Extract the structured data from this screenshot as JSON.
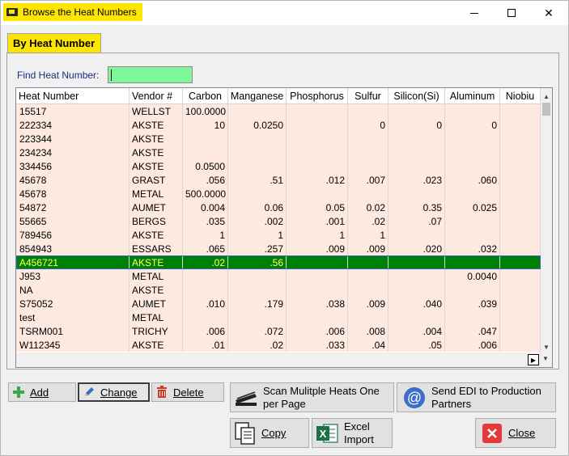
{
  "window": {
    "title": "Browse the Heat Numbers",
    "controls": {
      "minimize": "",
      "maximize": "",
      "close": "✕"
    }
  },
  "tab": {
    "label": "By Heat Number"
  },
  "find": {
    "label": "Find Heat Number:",
    "value": ""
  },
  "table": {
    "columns": [
      "Heat Number",
      "Vendor #",
      "Carbon",
      "Manganese",
      "Phosphorus",
      "Sulfur",
      "Silicon(Si)",
      "Aluminum",
      "Niobiu"
    ],
    "rows": [
      [
        "15517",
        "WELLST",
        "100.0000",
        "",
        "",
        "",
        "",
        "",
        ""
      ],
      [
        "222334",
        "AKSTE",
        "10",
        "0.0250",
        "",
        "0",
        "0",
        "0",
        ""
      ],
      [
        "223344",
        "AKSTE",
        "",
        "",
        "",
        "",
        "",
        "",
        ""
      ],
      [
        "234234",
        "AKSTE",
        "",
        "",
        "",
        "",
        "",
        "",
        ""
      ],
      [
        "334456",
        "AKSTE",
        "0.0500",
        "",
        "",
        "",
        "",
        "",
        ""
      ],
      [
        "45678",
        "GRAST",
        ".056",
        ".51",
        ".012",
        ".007",
        ".023",
        ".060",
        ""
      ],
      [
        "45678",
        "METAL",
        "500.0000",
        "",
        "",
        "",
        "",
        "",
        ""
      ],
      [
        "54872",
        "AUMET",
        "0.004",
        "0.06",
        "0.05",
        "0.02",
        "0.35",
        "0.025",
        ""
      ],
      [
        "55665",
        "BERGS",
        ".035",
        ".002",
        ".001",
        ".02",
        ".07",
        "",
        ""
      ],
      [
        "789456",
        "AKSTE",
        "1",
        "1",
        "1",
        "1",
        "",
        "",
        ""
      ],
      [
        "854943",
        "ESSARS",
        ".065",
        ".257",
        ".009",
        ".009",
        ".020",
        ".032",
        ""
      ],
      [
        "A456721",
        "AKSTE",
        ".02",
        ".56",
        "",
        "",
        "",
        "",
        ""
      ],
      [
        "J953",
        "METAL",
        "",
        "",
        "",
        "",
        "",
        "0.0040",
        ""
      ],
      [
        "NA",
        "AKSTE",
        "",
        "",
        "",
        "",
        "",
        "",
        ""
      ],
      [
        "S75052",
        "AUMET",
        ".010",
        ".179",
        ".038",
        ".009",
        ".040",
        ".039",
        ""
      ],
      [
        "test",
        "METAL",
        "",
        "",
        "",
        "",
        "",
        "",
        ""
      ],
      [
        "TSRM001",
        "TRICHY",
        ".006",
        ".072",
        ".006",
        ".008",
        ".004",
        ".047",
        ""
      ],
      [
        "W112345",
        "AKSTE",
        ".01",
        ".02",
        ".033",
        ".04",
        ".05",
        ".006",
        ""
      ]
    ],
    "selected_row": "A456721"
  },
  "buttons": {
    "add": "Add",
    "change": "Change",
    "delete": "Delete",
    "scan": "Scan Mulitple Heats One per Page",
    "edi": "Send EDI to Production Partners",
    "copy": "Copy",
    "excel": "Excel Import",
    "close": "Close"
  },
  "colors": {
    "title_chip": "#ffe600",
    "tab": "#ffe600",
    "row_bg": "#fde9e0",
    "selected_bg": "#008000",
    "selected_text": "#ffff66",
    "find_input": "#7ef79a"
  }
}
